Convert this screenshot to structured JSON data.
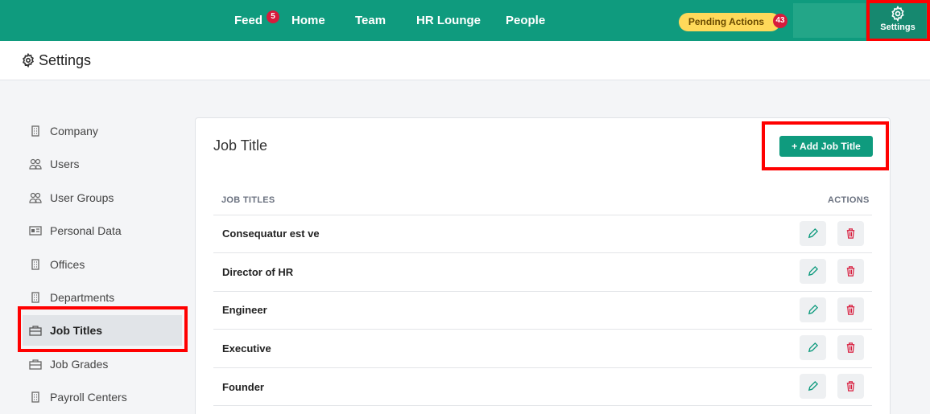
{
  "nav": {
    "feed": "Feed",
    "feed_badge": "5",
    "home": "Home",
    "team": "Team",
    "hr_lounge": "HR Lounge",
    "people": "People",
    "pending_actions": "Pending Actions",
    "pending_badge": "43",
    "settings": "Settings"
  },
  "page": {
    "title": "Settings"
  },
  "sidebar": {
    "items": [
      {
        "label": "Company",
        "icon": "building-icon"
      },
      {
        "label": "Users",
        "icon": "users-icon"
      },
      {
        "label": "User Groups",
        "icon": "users-icon"
      },
      {
        "label": "Personal Data",
        "icon": "id-card-icon"
      },
      {
        "label": "Offices",
        "icon": "building-icon"
      },
      {
        "label": "Departments",
        "icon": "building-icon"
      },
      {
        "label": "Job Titles",
        "icon": "briefcase-icon",
        "active": true
      },
      {
        "label": "Job Grades",
        "icon": "briefcase-icon"
      },
      {
        "label": "Payroll Centers",
        "icon": "building-icon"
      }
    ]
  },
  "card": {
    "title": "Job Title",
    "add_button": "+ Add Job Title",
    "col_titles": "JOB TITLES",
    "col_actions": "ACTIONS",
    "rows": [
      "Consequatur est ve",
      "Director of HR",
      "Engineer",
      "Executive",
      "Founder"
    ]
  },
  "colors": {
    "brand": "#0f9b7e",
    "pending": "#ffd95a",
    "badge": "#d81b3c",
    "highlight": "#ff0000"
  }
}
